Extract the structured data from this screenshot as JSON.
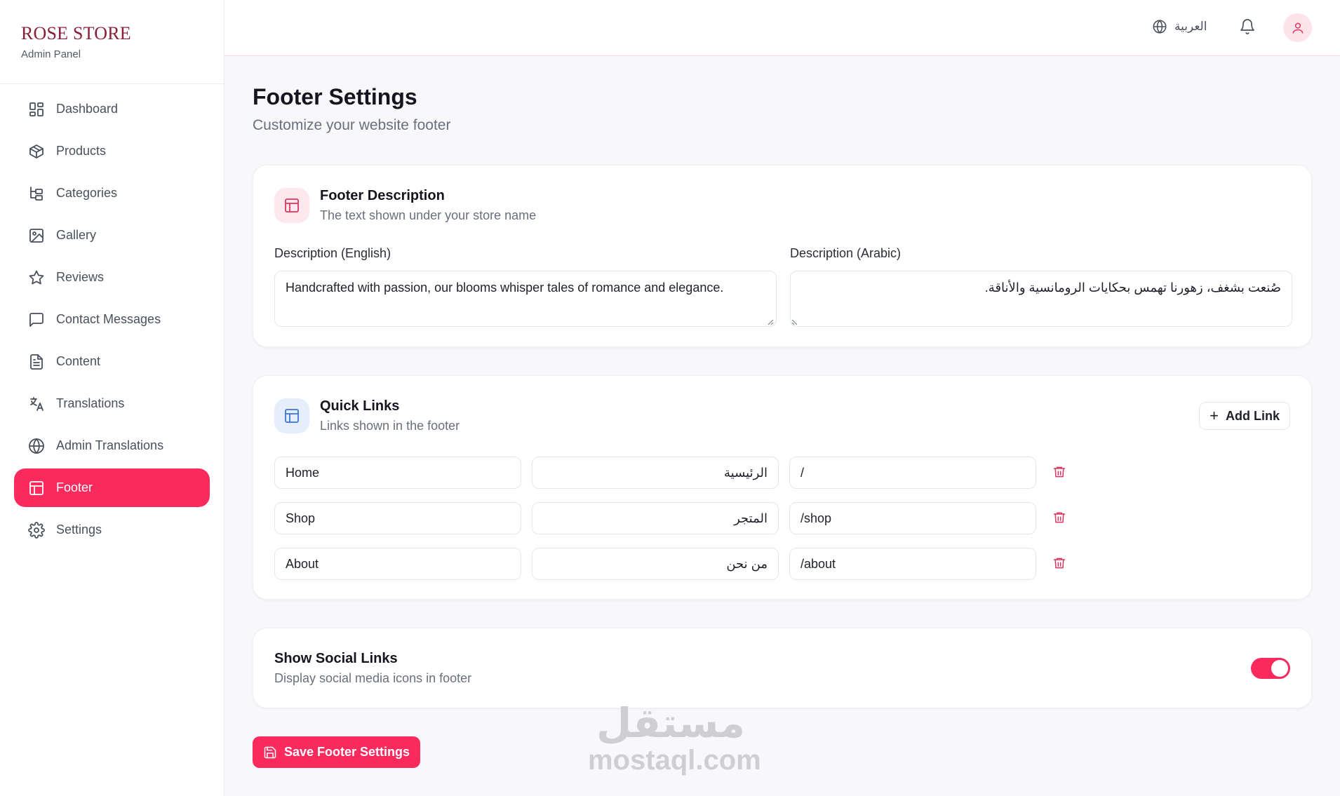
{
  "brand": {
    "title": "ROSE STORE",
    "subtitle": "Admin Panel"
  },
  "sidebar": {
    "items": [
      {
        "label": "Dashboard",
        "icon": "dashboard-icon"
      },
      {
        "label": "Products",
        "icon": "package-icon"
      },
      {
        "label": "Categories",
        "icon": "folder-tree-icon"
      },
      {
        "label": "Gallery",
        "icon": "image-icon"
      },
      {
        "label": "Reviews",
        "icon": "star-icon"
      },
      {
        "label": "Contact Messages",
        "icon": "message-icon"
      },
      {
        "label": "Content",
        "icon": "file-text-icon"
      },
      {
        "label": "Translations",
        "icon": "languages-icon"
      },
      {
        "label": "Admin Translations",
        "icon": "globe-icon"
      },
      {
        "label": "Footer",
        "icon": "layout-icon",
        "active": true
      },
      {
        "label": "Settings",
        "icon": "gear-icon"
      }
    ]
  },
  "topbar": {
    "language_label": "العربية"
  },
  "page": {
    "title": "Footer Settings",
    "subtitle": "Customize your website footer"
  },
  "footer_description": {
    "title": "Footer Description",
    "desc": "The text shown under your store name",
    "english_label": "Description (English)",
    "english_value": "Handcrafted with passion, our blooms whisper tales of romance and elegance.",
    "arabic_label": "Description (Arabic)",
    "arabic_value": "صُنعت بشغف، زهورنا تهمس بحكايات الرومانسية والأناقة."
  },
  "quick_links": {
    "title": "Quick Links",
    "desc": "Links shown in the footer",
    "add_label": "Add Link",
    "rows": [
      {
        "name_en": "Home",
        "name_ar": "الرئيسية",
        "url": "/"
      },
      {
        "name_en": "Shop",
        "name_ar": "المتجر",
        "url": "/shop"
      },
      {
        "name_en": "About",
        "name_ar": "من نحن",
        "url": "/about"
      }
    ]
  },
  "social": {
    "title": "Show Social Links",
    "desc": "Display social media icons in footer",
    "enabled": true
  },
  "save_label": "Save Footer Settings",
  "watermark": {
    "arabic": "مستقل",
    "latin": "mostaql.com"
  },
  "colors": {
    "accent": "#fb2a5d",
    "brand": "#8a1f3b",
    "icon_blue": "#3b74d8"
  }
}
